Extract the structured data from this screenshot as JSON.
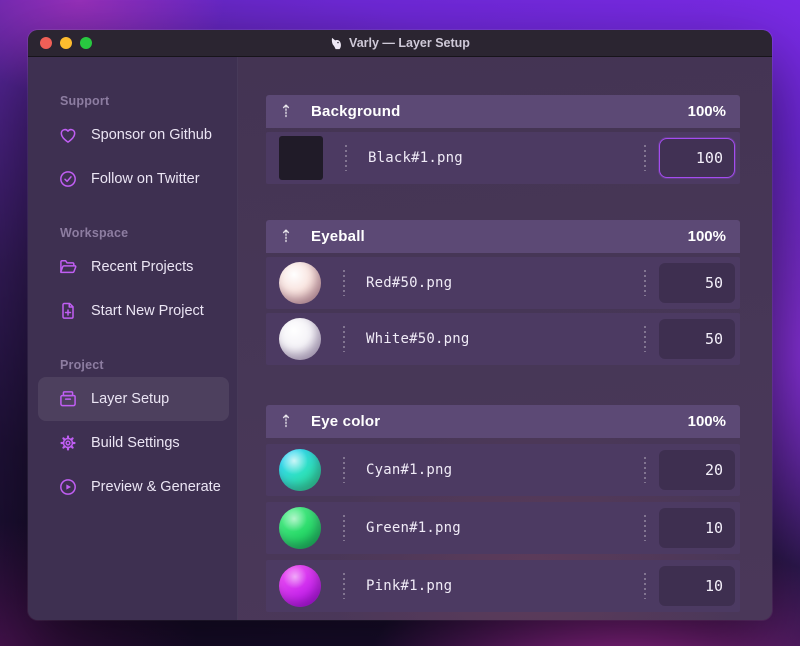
{
  "window": {
    "title": "Varly — Layer Setup",
    "app_icon": "unicorn",
    "traffic_lights": {
      "close": "red",
      "minimize": "yellow",
      "zoom": "green"
    }
  },
  "sidebar": {
    "sections": [
      {
        "label": "Support",
        "items": [
          {
            "icon": "heart-icon",
            "label": "Sponsor on Github"
          },
          {
            "icon": "verified-check-icon",
            "label": "Follow on Twitter"
          }
        ]
      },
      {
        "label": "Workspace",
        "items": [
          {
            "icon": "folder-icon",
            "label": "Recent Projects"
          },
          {
            "icon": "file-plus-icon",
            "label": "Start New Project"
          }
        ]
      },
      {
        "label": "Project",
        "items": [
          {
            "icon": "archive-icon",
            "label": "Layer Setup",
            "selected": true
          },
          {
            "icon": "gear-icon",
            "label": "Build Settings"
          },
          {
            "icon": "play-circle-icon",
            "label": "Preview & Generate"
          }
        ]
      }
    ]
  },
  "main": {
    "groups": [
      {
        "name": "Background",
        "opacity": "100%",
        "layers": [
          {
            "file": "Black#1.png",
            "value": "100",
            "focused": true,
            "swatch": "black-square"
          }
        ]
      },
      {
        "name": "Eyeball",
        "opacity": "100%",
        "layers": [
          {
            "file": "Red#50.png",
            "value": "50",
            "swatch": "red-sphere"
          },
          {
            "file": "White#50.png",
            "value": "50",
            "swatch": "white-sphere"
          }
        ]
      },
      {
        "name": "Eye color",
        "opacity": "100%",
        "layers": [
          {
            "file": "Cyan#1.png",
            "value": "20",
            "swatch": "cyan-sphere"
          },
          {
            "file": "Green#1.png",
            "value": "10",
            "swatch": "green-sphere"
          },
          {
            "file": "Pink#1.png",
            "value": "10",
            "swatch": "pink-sphere"
          }
        ]
      }
    ]
  },
  "colors": {
    "accent": "#a44cf0",
    "sidebar_icon": "#c05ef3",
    "group_header_bg": "#5c4975",
    "row_bg": "#4c3a62",
    "titlebar_bg": "#2b2531",
    "traffic_red": "#f05f57",
    "traffic_yellow": "#fdbc2e",
    "traffic_green": "#28c840"
  }
}
